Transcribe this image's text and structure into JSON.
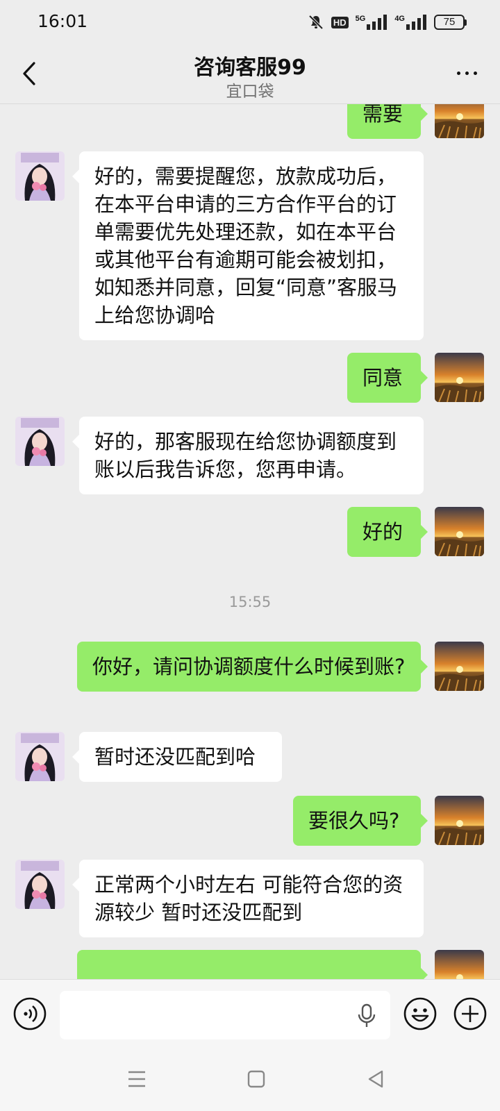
{
  "status_bar": {
    "time": "16:01",
    "network_badge": "HD",
    "signal_1": "5G",
    "signal_2": "4G",
    "battery": "75"
  },
  "header": {
    "title": "咨询客服99",
    "subtitle": "宜口袋",
    "back_icon": "chevron-left-icon",
    "more_icon": "more-dots-icon"
  },
  "messages": [
    {
      "side": "out",
      "text": "需要"
    },
    {
      "side": "in",
      "text": "好的，需要提醒您，放款成功后，在本平台申请的三方合作平台的订单需要优先处理还款，如在本平台或其他平台有逾期可能会被划扣，如知悉并同意，回复“同意”客服马上给您协调哈"
    },
    {
      "side": "out",
      "text": "同意"
    },
    {
      "side": "in",
      "text": "好的，那客服现在给您协调额度到账以后我告诉您，您再申请。"
    },
    {
      "side": "out",
      "text": "好的"
    },
    {
      "side": "time",
      "text": "15:55"
    },
    {
      "side": "out",
      "text": "你好，请问协调额度什么时候到账?"
    },
    {
      "side": "in",
      "text": "暂时还没匹配到哈"
    },
    {
      "side": "out",
      "text": "要很久吗?"
    },
    {
      "side": "in",
      "text": "正常两个小时左右 可能符合您的资源较少  暂时还没匹配到"
    },
    {
      "side": "out",
      "text": ""
    }
  ],
  "input_bar": {
    "placeholder": "",
    "voice_icon": "voice-icon",
    "mic_icon": "microphone-icon",
    "emoji_icon": "emoji-icon",
    "plus_icon": "plus-icon"
  },
  "colors": {
    "background": "#ededed",
    "outgoing_bubble": "#95ec69",
    "incoming_bubble": "#ffffff"
  }
}
